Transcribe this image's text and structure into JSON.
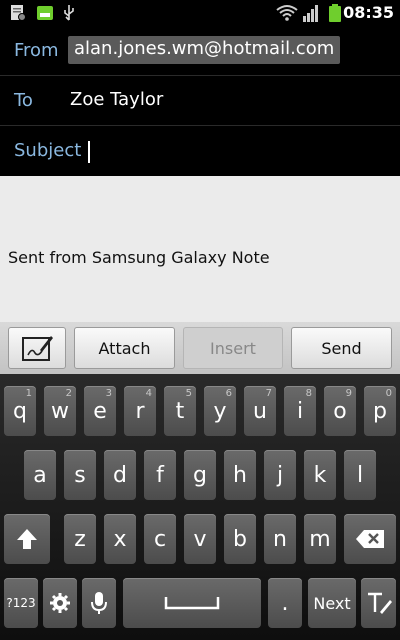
{
  "status": {
    "time": "08:35",
    "icons": [
      "notification-icon",
      "nox-icon",
      "usb-icon",
      "wifi-icon",
      "signal-icon",
      "battery-icon"
    ],
    "colors": {
      "battery": "#6fce2d",
      "nox": "#6fce2d"
    }
  },
  "compose": {
    "from_label": "From",
    "from_value": "alan.jones.wm@hotmail.com",
    "to_label": "To",
    "to_value": "Zoe Taylor",
    "subject_label": "Subject",
    "subject_value": "",
    "body_signature": "Sent from Samsung Galaxy Note"
  },
  "actions": {
    "attach": "Attach",
    "insert": "Insert",
    "send": "Send"
  },
  "keyboard": {
    "row1": [
      {
        "k": "q",
        "s": "1"
      },
      {
        "k": "w",
        "s": "2"
      },
      {
        "k": "e",
        "s": "3"
      },
      {
        "k": "r",
        "s": "4"
      },
      {
        "k": "t",
        "s": "5"
      },
      {
        "k": "y",
        "s": "6"
      },
      {
        "k": "u",
        "s": "7"
      },
      {
        "k": "i",
        "s": "8"
      },
      {
        "k": "o",
        "s": "9"
      },
      {
        "k": "p",
        "s": "0"
      }
    ],
    "row2": [
      "a",
      "s",
      "d",
      "f",
      "g",
      "h",
      "j",
      "k",
      "l"
    ],
    "row3": [
      "z",
      "x",
      "c",
      "v",
      "b",
      "n",
      "m"
    ],
    "sym_label": "?123",
    "period": ".",
    "next_label": "Next"
  }
}
